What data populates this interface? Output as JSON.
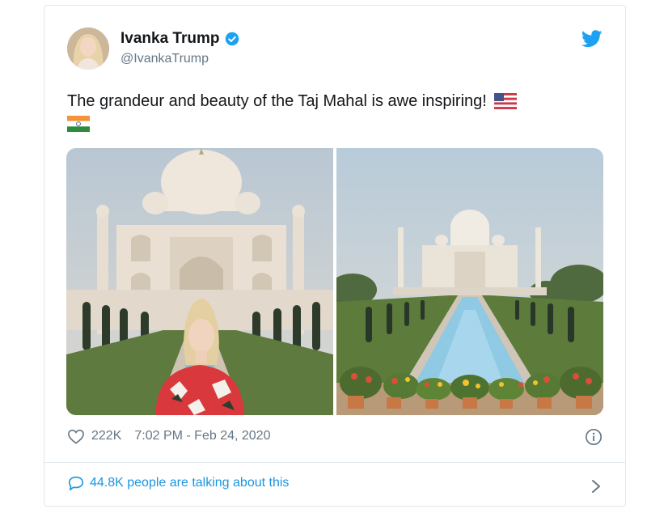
{
  "author": {
    "name": "Ivanka Trump",
    "handle": "@IvankaTrump"
  },
  "tweet": {
    "text": "The grandeur and beauty of the Taj Mahal is awe inspiring!",
    "emoji": [
      "us-flag-icon",
      "india-flag-icon"
    ]
  },
  "media": {
    "image_count": 2,
    "left_image": "person-in-front-of-taj-mahal",
    "right_image": "taj-mahal-reflecting-pool"
  },
  "stats": {
    "likes": "222K",
    "timestamp": "7:02 PM - Feb 24, 2020"
  },
  "conversation": {
    "label": "44.8K people are talking about this"
  },
  "icons": {
    "verified": "verified-badge-icon",
    "brand": "twitter-bird-icon",
    "like": "heart-icon",
    "info": "info-icon",
    "reply": "speech-bubble-icon",
    "more": "chevron-right-icon"
  },
  "colors": {
    "accent": "#1da1f2",
    "link": "#1b95e0",
    "text": "#14171a",
    "muted": "#657786",
    "border": "#e1e8ed"
  }
}
